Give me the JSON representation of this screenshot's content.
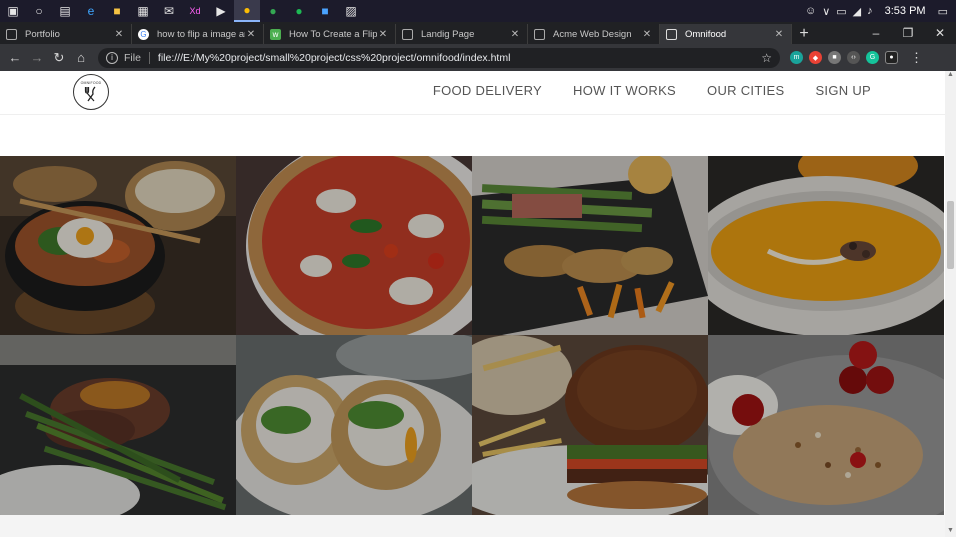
{
  "taskbar": {
    "icons": [
      "windows-icon",
      "search-icon",
      "task-view-icon",
      "edge-icon",
      "file-explorer-icon",
      "store-icon",
      "mail-icon",
      "xd-icon",
      "terminal-icon",
      "chrome-icon",
      "browser-icon",
      "spotify-icon",
      "remote-desktop-icon",
      "photos-icon"
    ],
    "clock": "3:53 PM"
  },
  "tabs": [
    {
      "label": "Portfolio",
      "favicon": "page-icon",
      "active": false
    },
    {
      "label": "how to flip a image and",
      "favicon": "google-icon",
      "active": false
    },
    {
      "label": "How To Create a Flip C",
      "favicon": "w3-icon",
      "active": false
    },
    {
      "label": "Landig Page",
      "favicon": "page-icon",
      "active": false
    },
    {
      "label": "Acme Web Design",
      "favicon": "page-icon",
      "active": false
    },
    {
      "label": "Omnifood",
      "favicon": "page-icon",
      "active": true
    }
  ],
  "toolbar": {
    "scheme": "File",
    "url": "file:///E:/My%20project/small%20project/css%20project/omnifood/index.html"
  },
  "site": {
    "logo_text": "OMNIFOOD",
    "nav": [
      "FOOD DELIVERY",
      "HOW IT WORKS",
      "OUR CITIES",
      "SIGN UP"
    ]
  },
  "gallery": [
    {
      "name": "bibimbap-bowl"
    },
    {
      "name": "margherita-pizza"
    },
    {
      "name": "chicken-asparagus-plate"
    },
    {
      "name": "pumpkin-soup"
    },
    {
      "name": "steak-green-beans"
    },
    {
      "name": "wrap-sandwich"
    },
    {
      "name": "burger-fries"
    },
    {
      "name": "granola-berries"
    }
  ]
}
